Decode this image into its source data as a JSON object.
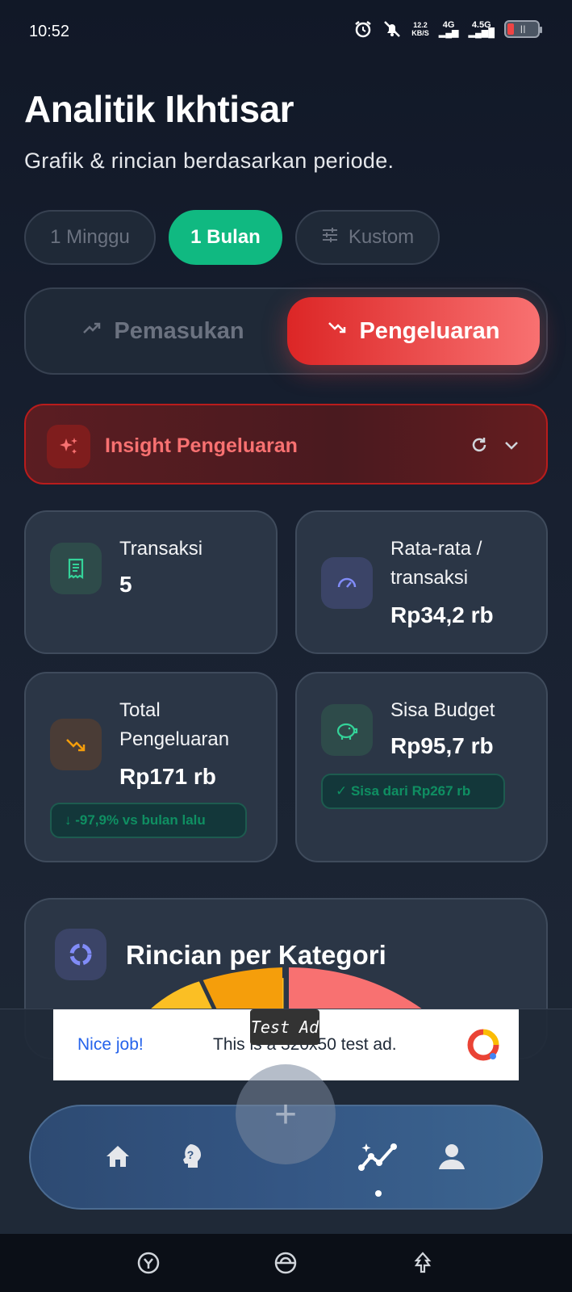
{
  "status_bar": {
    "time": "10:52",
    "speed_top": "12.2",
    "speed_bottom": "KB/S",
    "net1": "4G",
    "net2": "4.5G",
    "icons": [
      "alarm-icon",
      "bell-off-icon",
      "signal-icon",
      "battery-icon"
    ]
  },
  "header": {
    "title": "Analitik Ikhtisar",
    "subtitle": "Grafik & rincian berdasarkan periode."
  },
  "period_chips": [
    {
      "label": "1 Minggu",
      "active": false
    },
    {
      "label": "1 Bulan",
      "active": true
    },
    {
      "label": "Kustom",
      "active": false,
      "icon": "sliders-icon"
    }
  ],
  "type_toggle": {
    "income_label": "Pemasukan",
    "expense_label": "Pengeluaran",
    "selected": "Pengeluaran"
  },
  "insight": {
    "title": "Insight Pengeluaran",
    "icons": [
      "sparkles-icon",
      "refresh-icon",
      "chevron-down-icon"
    ]
  },
  "stats": {
    "transactions": {
      "label": "Transaksi",
      "value": "5"
    },
    "average": {
      "label_line1": "Rata-rata /",
      "label_line2": "transaksi",
      "value": "Rp34,2 rb"
    },
    "total": {
      "label_line1": "Total",
      "label_line2": "Pengeluaran",
      "value": "Rp171 rb",
      "badge": "↓ -97,9% vs bulan lalu"
    },
    "budget": {
      "label": "Sisa Budget",
      "value": "Rp95,7 rb",
      "badge": "✓ Sisa dari Rp267 rb"
    }
  },
  "breakdown": {
    "title": "Rincian per Kategori"
  },
  "ad": {
    "left_text": "Nice job!",
    "center_text": "This is a 320x50 test ad.",
    "tag": "Test Ad"
  },
  "fab": {
    "label": "+"
  },
  "bottom_nav": {
    "items": [
      "home-icon",
      "help-head-icon",
      "analytics-icon",
      "profile-icon"
    ],
    "selected": "analytics-icon"
  },
  "colors": {
    "accent_green": "#10b981",
    "accent_red": "#ef4444",
    "background": "#182030"
  }
}
